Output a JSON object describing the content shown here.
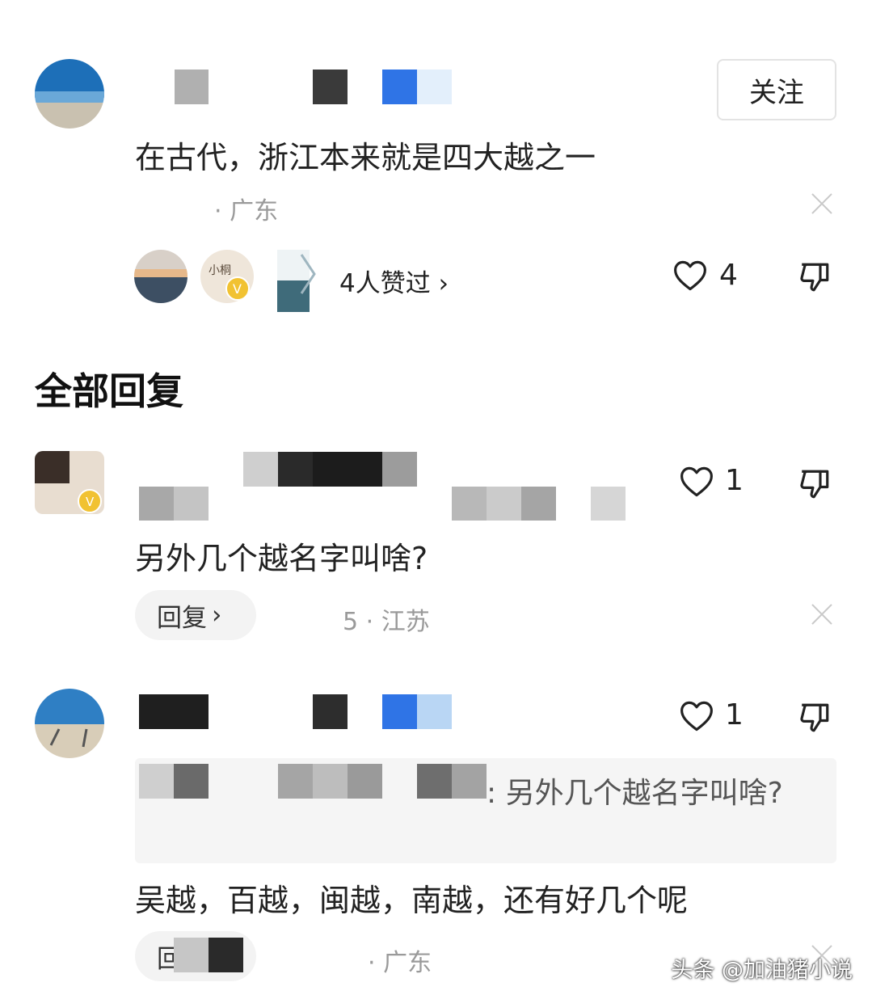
{
  "comment": {
    "follow_label": "关注",
    "text": "在古代，浙江本来就是四大越之一",
    "location": "· 广东",
    "likers_text": "4人赞过",
    "likers_chevron": "›",
    "like_count": "4"
  },
  "replies_section": {
    "title": "全部回复"
  },
  "reply1": {
    "text": "另外几个越名字叫啥?",
    "reply_label": "回复",
    "reply_chevron": "›",
    "meta": "5 · 江苏",
    "like_count": "1"
  },
  "reply2": {
    "quote": ": 另外几个越名字叫啥?",
    "text": "吴越，百越，闽越，南越，还有好几个呢",
    "reply_label": "回",
    "location": "· 广东",
    "like_count": "1"
  },
  "watermark": "头条 @加油猪小说",
  "colors": {
    "accent_blue": "#2f74e6",
    "gold_badge": "#f1c232",
    "meta_gray": "#9a9a9a"
  }
}
